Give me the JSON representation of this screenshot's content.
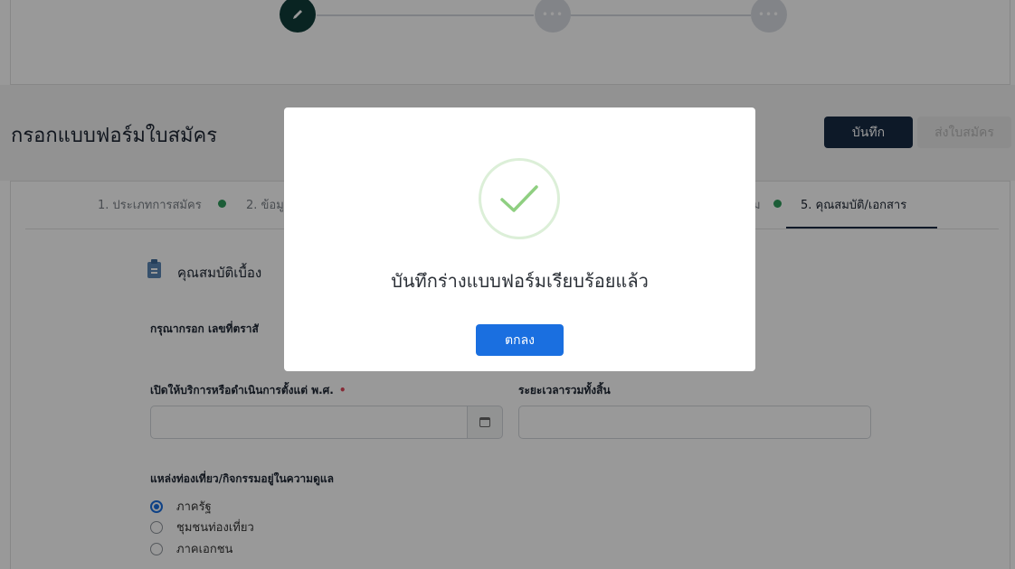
{
  "stepper": {
    "steps": [
      {
        "state": "active",
        "icon": "pencil-icon"
      },
      {
        "state": "pending",
        "icon": "dots-icon",
        "glyph": "•••"
      },
      {
        "state": "pending",
        "icon": "dots-icon",
        "glyph": "•••"
      }
    ]
  },
  "header": {
    "title": "กรอกแบบฟอร์มใบสมัคร",
    "save_label": "บันทึก",
    "submit_label": "ส่งใบสมัคร"
  },
  "tabs": [
    {
      "label": "1. ประเภทการสมัคร",
      "status": "complete"
    },
    {
      "label": "2. ข้อมู",
      "status": "complete"
    },
    {
      "label": "ม",
      "status": "complete"
    },
    {
      "label": "5. คุณสมบัติ/เอกสาร",
      "status": "active"
    }
  ],
  "section": {
    "title": "คุณสมบัติเบื้อง",
    "note": "กรุณากรอก เลขที่ตราสั"
  },
  "fields": {
    "start_year_label": "เปิดให้บริการหรือดำเนินการตั้งแต่ พ.ศ.",
    "start_year_required": "•",
    "start_year_value": "",
    "duration_label": "ระยะเวลารวมทั้งสิ้น",
    "duration_value": ""
  },
  "ownership": {
    "label": "แหล่งท่องเที่ยว/กิจกรรมอยู่ในความดูแล",
    "options": [
      {
        "label": "ภาครัฐ",
        "selected": true
      },
      {
        "label": "ชุมชนท่องเที่ยว",
        "selected": false
      },
      {
        "label": "ภาคเอกชน",
        "selected": false
      }
    ]
  },
  "modal": {
    "icon": "checkmark-icon",
    "message": "บันทึกร่างแบบฟอร์มเรียบร้อยแล้ว",
    "ok_label": "ตกลง"
  },
  "colors": {
    "primary": "#172a44",
    "accent": "#1a6fe0",
    "success": "#2f9b5c",
    "required": "#e0465a"
  }
}
